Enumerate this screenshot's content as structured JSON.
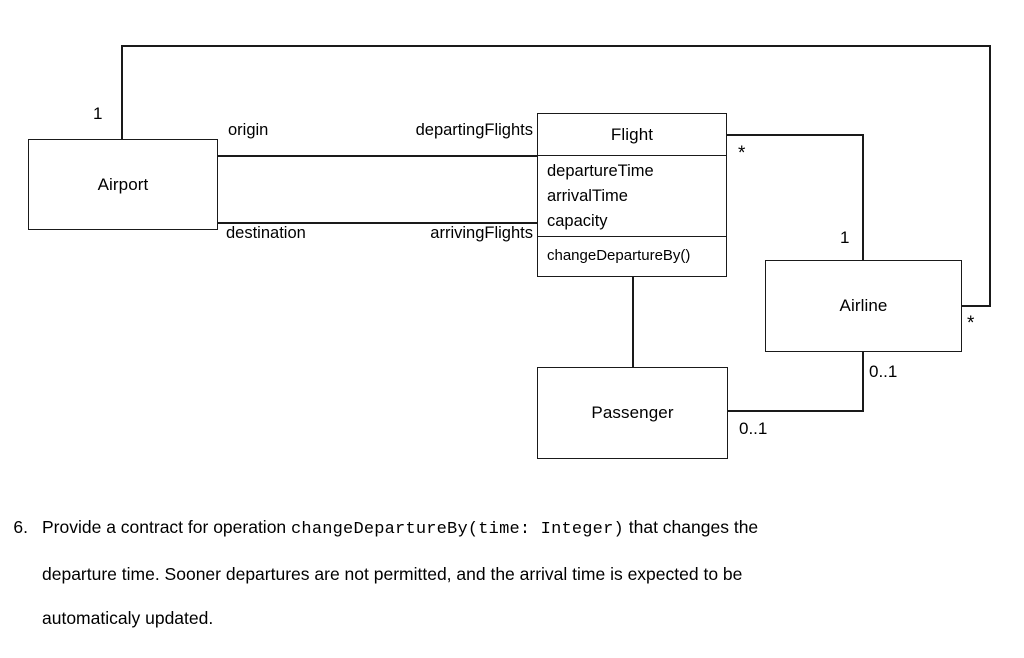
{
  "diagram": {
    "type": "uml-class-diagram",
    "classes": [
      {
        "id": "airport",
        "name": "Airport",
        "attributes": [],
        "operations": []
      },
      {
        "id": "flight",
        "name": "Flight",
        "attributes": [
          "departureTime",
          "arrivalTime",
          "capacity"
        ],
        "operations": [
          "changeDepartureBy()"
        ]
      },
      {
        "id": "airline",
        "name": "Airline",
        "attributes": [],
        "operations": []
      },
      {
        "id": "passenger",
        "name": "Passenger",
        "attributes": [],
        "operations": []
      }
    ],
    "association_labels": {
      "origin": "origin",
      "departing_flights": "departingFlights",
      "destination": "destination",
      "arriving_flights": "arrivingFlights"
    },
    "multiplicities": {
      "airport_top": "1",
      "flight_to_airline": "*",
      "airline_top": "1",
      "airline_right": "*",
      "airline_bottom": "0..1",
      "passenger_right": "0..1"
    }
  },
  "question": {
    "number": "6.",
    "text_before_code": "Provide a contract for operation ",
    "code": "changeDepartureBy(time: Integer)",
    "text_after_code": " that changes the",
    "line2": "departure time.  Sooner departures are not permitted, and the arrival time is expected to be",
    "line3": "automaticaly updated."
  }
}
